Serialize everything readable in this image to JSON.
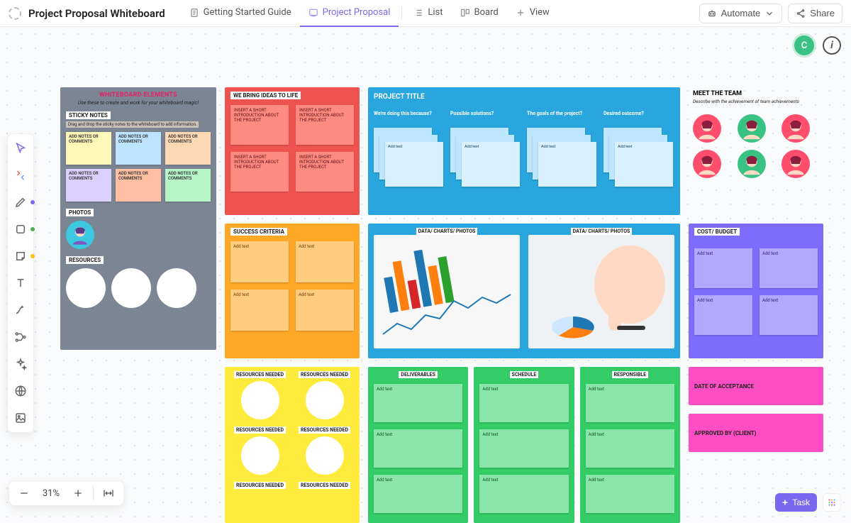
{
  "header": {
    "title": "Project Proposal Whiteboard",
    "tabs": {
      "guide": "Getting Started Guide",
      "proposal": "Project Proposal",
      "list": "List",
      "board": "Board",
      "view": "View"
    },
    "automate": "Automate",
    "share": "Share"
  },
  "toolbar_dots": [
    "purple",
    "",
    "green",
    "yellow",
    "",
    "",
    "",
    "",
    "",
    ""
  ],
  "user_initial": "C",
  "zoom": {
    "percent": "31%"
  },
  "task_button": "Task",
  "whiteboard_elements": {
    "heading": "WHITEBOARD ELEMENTS",
    "sub": "Use these to create and work for your whiteboard magic!",
    "sticky_label": "STICKY NOTES",
    "sticky_hint": "Drag and drop the sticky notes to the whiteboard to add information.",
    "sticky_text": "ADD NOTES OR COMMENTS",
    "photos_label": "PHOTOS",
    "resources_label": "RESOURCES"
  },
  "sticky_colors": [
    "#fff8b8",
    "#bde4ff",
    "#ffd9b3",
    "#dcd0ff",
    "#ffbfa3",
    "#b5f5c6"
  ],
  "ideas": {
    "title": "WE BRING IDEAS TO LIFE",
    "note_text": "INSERT A SHORT INTRODUCTION ABOUT THE PROJECT"
  },
  "project": {
    "title": "PROJECT TITLE",
    "cols": [
      "We're doing this because?",
      "Possible solutions?",
      "The goals of the project?",
      "Desired outcome?"
    ],
    "card_text": "Add text"
  },
  "team": {
    "title": "MEET THE TEAM",
    "sub": "Describe with the achievement of team achievements",
    "bg": [
      "#ff4d6d",
      "#3ac283",
      "#ff4d6d",
      "#ff4d6d",
      "#3ac283",
      "#ff4d6d"
    ]
  },
  "success": {
    "title": "SUCCESS CRITERIA",
    "note": "Add text"
  },
  "data_label": "DATA/ CHARTS/ PHOTOS",
  "cost": {
    "title": "COST/ BUDGET",
    "note": "Add text"
  },
  "resources_needed": {
    "label": "RESOURCES NEEDED"
  },
  "green_cols": {
    "deliverables": "DELIVERABLES",
    "schedule": "SCHEDULE",
    "responsible": "RESPONSIBLE",
    "note": "Add text"
  },
  "pink": {
    "date": "DATE OF ACCEPTANCE",
    "approved": "APPROVED BY (CLIENT)"
  }
}
